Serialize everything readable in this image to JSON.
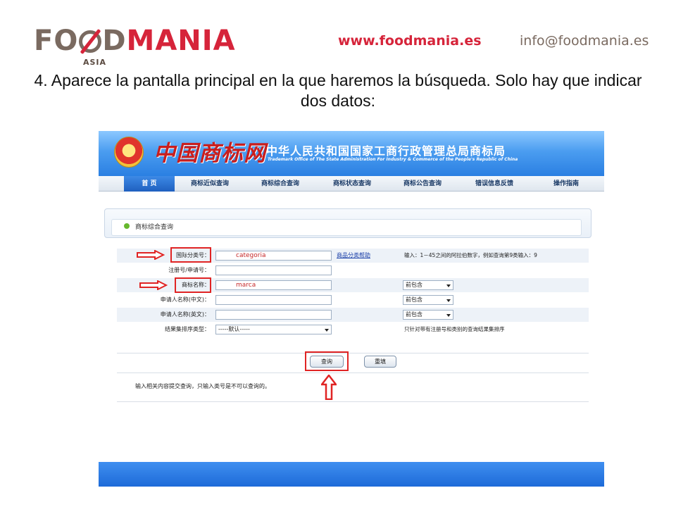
{
  "slide": {
    "logo_food": "FO",
    "logo_dmania_d": "D",
    "logo_mania": "MANIA",
    "logo_sub": "ASIA",
    "website": "www.foodmania.es",
    "email": "info@foodmania.es",
    "caption": "4. Aparece la pantalla principal en la que haremos la búsqueda. Solo hay que indicar dos datos:"
  },
  "site": {
    "brand_cn": "中国商标网",
    "office_cn": "中华人民共和国国家工商行政管理总局商标局",
    "office_en": "Trademark Office of The State Administration For Industry & Commerce of the People's Republic of China",
    "nav": [
      {
        "label": "首  页",
        "active": true
      },
      {
        "label": "商标近似查询",
        "active": false
      },
      {
        "label": "商标综合查询",
        "active": false
      },
      {
        "label": "商标状态查询",
        "active": false
      },
      {
        "label": "商标公告查询",
        "active": false
      },
      {
        "label": "错误信息反馈",
        "active": false
      },
      {
        "label": "操作指南",
        "active": false
      }
    ],
    "panel_title": "商标综合查询",
    "form": {
      "class_label": "国际分类号：",
      "class_value": "categoria",
      "class_help": "商品分类帮助",
      "class_hint": "输入：1－45之间的阿拉伯数字，例如查询第9类输入：9",
      "regno_label": "注册号/申请号：",
      "regno_value": "",
      "name_label": "商标名称：",
      "name_value": "marca",
      "name_match": "前包含",
      "applicant_cn_label": "申请人名称(中文)：",
      "applicant_cn_value": "",
      "applicant_cn_match": "前包含",
      "applicant_en_label": "申请人名称(英文)：",
      "applicant_en_value": "",
      "applicant_en_match": "前包含",
      "sort_label": "结果集排序类型：",
      "sort_value": "-----默认-----",
      "sort_hint": "只针对带有注册号和类别的查询结果集排序"
    },
    "buttons": {
      "search": "查询",
      "reset": "重填"
    },
    "note": "输入相关内容提交查询，只输入类号是不可以查询的。"
  },
  "colors": {
    "annotation_red": "#e02424",
    "banner_blue": "#2a7fe2",
    "brand_red": "#d6243a"
  }
}
